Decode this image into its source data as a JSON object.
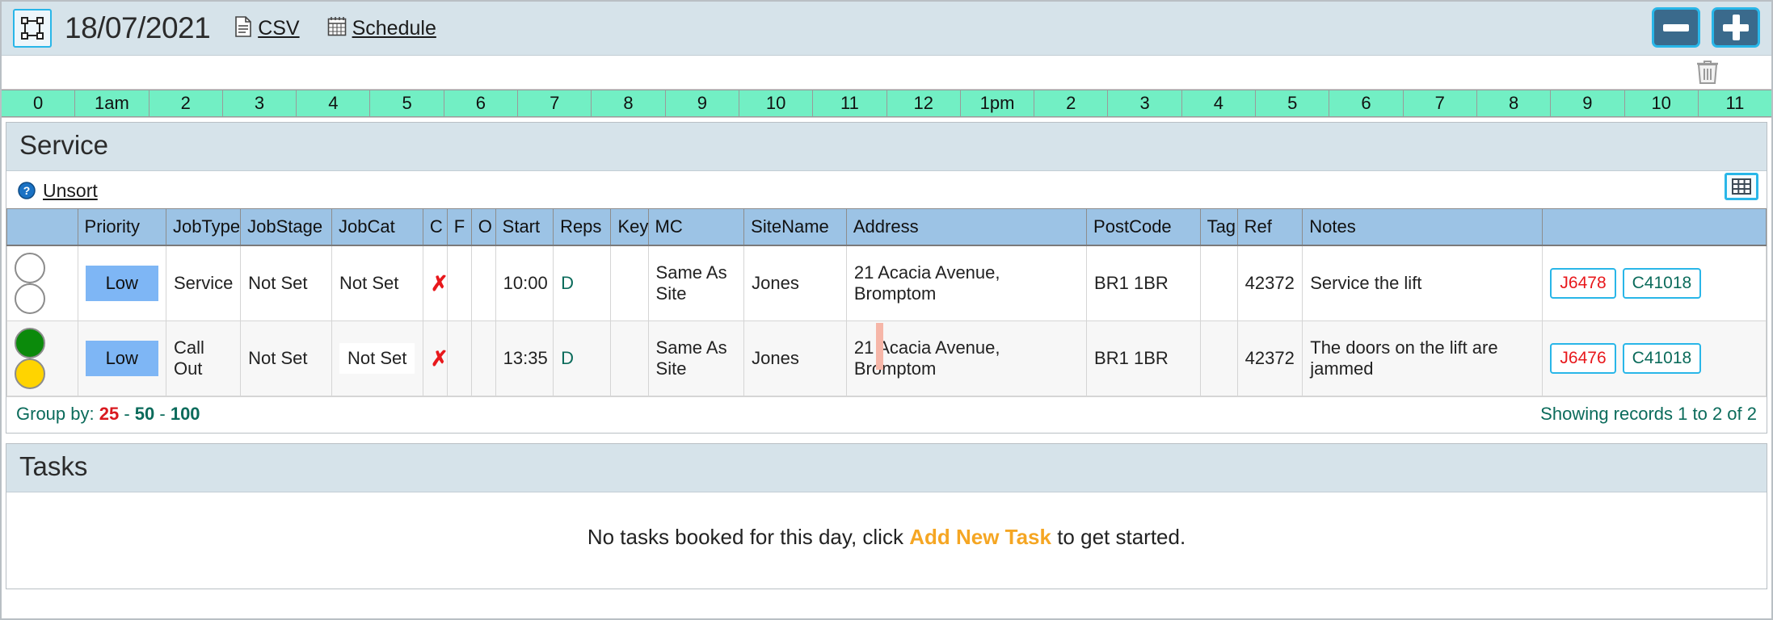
{
  "topbar": {
    "resize_icon": "resize-select-icon",
    "date": "18/07/2021",
    "csv_label": "CSV",
    "csv_icon": "document-icon",
    "schedule_label": "Schedule",
    "schedule_icon": "calendar-icon",
    "minus_button": "minus-icon",
    "plus_button": "plus-icon",
    "accent_cyan": "#29b6e8",
    "button_fill": "#3a6a8c",
    "bar_bg": "#d6e3ea"
  },
  "timeline": {
    "trash_icon": "trash-icon",
    "band_color": "#72efc4",
    "hours": [
      "0",
      "1am",
      "2",
      "3",
      "4",
      "5",
      "6",
      "7",
      "8",
      "9",
      "10",
      "11",
      "12",
      "1pm",
      "2",
      "3",
      "4",
      "5",
      "6",
      "7",
      "8",
      "9",
      "10",
      "11"
    ]
  },
  "service_panel": {
    "title": "Service",
    "help_icon": "help-circle-icon",
    "unsort_label": "Unsort",
    "grid_icon": "table-grid-icon",
    "columns": [
      "",
      "Priority",
      "JobType",
      "JobStage",
      "JobCat",
      "C",
      "F",
      "O",
      "Start",
      "Reps",
      "Key",
      "MC",
      "SiteName",
      "Address",
      "PostCode",
      "Tag",
      "Ref",
      "Notes",
      ""
    ],
    "rows": [
      {
        "status_dots": [
          "empty",
          "empty"
        ],
        "priority": "Low",
        "jobtype": "Service",
        "jobstage": "Not Set",
        "jobcat": "Not Set",
        "jobcat_boxed": false,
        "c": "✗",
        "f": "",
        "o": "",
        "start": "10:00",
        "reps": "D",
        "key": "",
        "mc": "Same As Site",
        "mc_highlight": true,
        "sitename": "Jones",
        "address": "21 Acacia Avenue, Bromptom",
        "address_marker": false,
        "postcode": "BR1 1BR",
        "tag": "",
        "ref": "42372",
        "notes": "Service the lift",
        "job_button": "J6478",
        "contract_button": "C41018"
      },
      {
        "status_dots": [
          "green",
          "yellow"
        ],
        "priority": "Low",
        "jobtype": "Call Out",
        "jobstage": "Not Set",
        "jobcat": "Not Set",
        "jobcat_boxed": true,
        "c": "✗",
        "f": "",
        "o": "",
        "start": "13:35",
        "reps": "D",
        "key": "",
        "mc": "Same As Site",
        "mc_highlight": false,
        "sitename": "Jones",
        "address": "21 Acacia Avenue, Bromptom",
        "address_marker": true,
        "postcode": "BR1 1BR",
        "tag": "",
        "ref": "42372",
        "notes": "The doors on the lift are jammed",
        "job_button": "J6476",
        "contract_button": "C41018"
      }
    ],
    "footer": {
      "group_by_label": "Group by:",
      "group_options": [
        "25",
        "50",
        "100"
      ],
      "group_active": "25",
      "separator": "-",
      "showing": "Showing records 1 to 2 of 2"
    }
  },
  "tasks_panel": {
    "title": "Tasks",
    "empty_prefix": "No tasks booked for this day, click",
    "empty_link": "Add New Task",
    "empty_suffix": "to get started."
  }
}
